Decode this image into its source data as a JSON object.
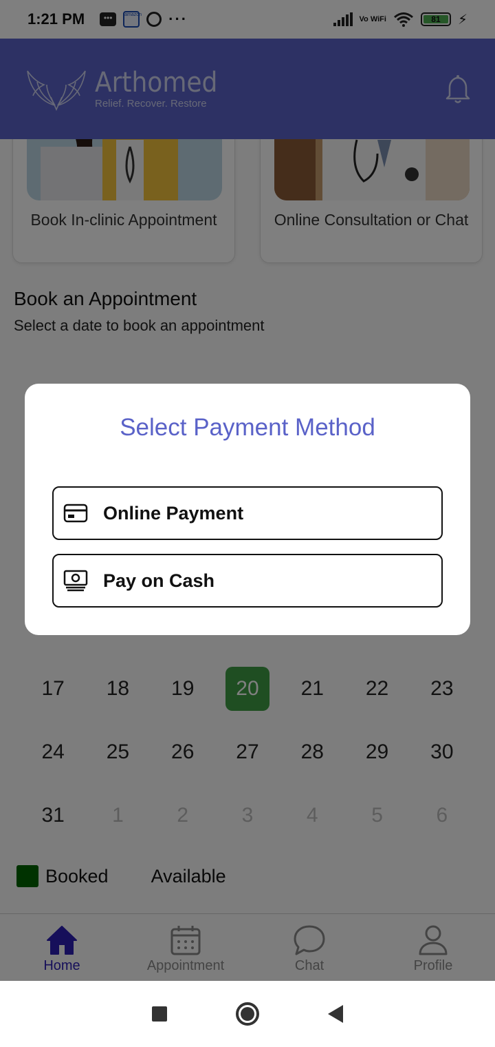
{
  "status_bar": {
    "time": "1:21 PM",
    "amazon_label": "amazon",
    "vowifi_label": "Vo WiFi",
    "battery": "81",
    "icons": [
      "message-icon",
      "amazon-icon",
      "circle-icon",
      "more-dots-icon",
      "signal-icon",
      "vowifi-icon",
      "wifi-icon",
      "battery-icon",
      "charging-icon"
    ]
  },
  "header": {
    "brand_name": "Arthomed",
    "tagline": "Relief. Recover. Restore",
    "colors": {
      "primary": "#5a62c8",
      "selected_date": "#3e9c44",
      "booked": "#006400",
      "nav_active": "#2d1fb5"
    }
  },
  "cards": [
    {
      "label": "Book In-clinic Appointment"
    },
    {
      "label": "Online Consultation or Chat"
    }
  ],
  "appointment": {
    "title": "Book an Appointment",
    "subtitle": "Select a date to book an appointment",
    "rows": [
      [
        "17",
        "18",
        "19",
        "20",
        "21",
        "22",
        "23"
      ],
      [
        "24",
        "25",
        "26",
        "27",
        "28",
        "29",
        "30"
      ],
      [
        "31",
        "1",
        "2",
        "3",
        "4",
        "5",
        "6"
      ]
    ],
    "selected": "20",
    "legend_booked": "Booked",
    "legend_available": "Available"
  },
  "dialog": {
    "title": "Select Payment Method",
    "online_label": "Online Payment",
    "cash_label": "Pay on Cash"
  },
  "bottom_nav": {
    "home": "Home",
    "appointment": "Appointment",
    "chat": "Chat",
    "profile": "Profile"
  }
}
